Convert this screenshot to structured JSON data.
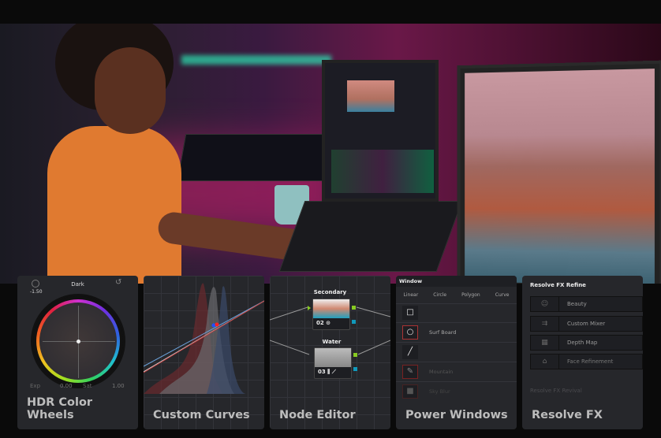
{
  "cards": {
    "hdr": {
      "title": "HDR Color Wheels",
      "wheel_label": "Dark",
      "wheel_value": "-1.50",
      "exp_label": "Exp",
      "exp_value": "0.00",
      "sat_label": "Sat",
      "sat_value": "1.00"
    },
    "curves": {
      "title": "Custom Curves"
    },
    "nodes": {
      "title": "Node Editor",
      "node1_label": "Secondary",
      "node1_num": "02",
      "node2_label": "Water",
      "node2_num": "03"
    },
    "power": {
      "title": "Power Windows",
      "header": "Window",
      "tools": [
        "Linear",
        "Circle",
        "Polygon",
        "Curve"
      ],
      "rows": [
        "",
        "Surf Board",
        "",
        "Mountain",
        "Sky Blur"
      ]
    },
    "fx": {
      "title": "Resolve FX",
      "header": "Resolve FX Refine",
      "items": [
        "Beauty",
        "Custom Mixer",
        "Depth Map",
        "Face Refinement"
      ],
      "footer": "Resolve FX Revival"
    }
  }
}
